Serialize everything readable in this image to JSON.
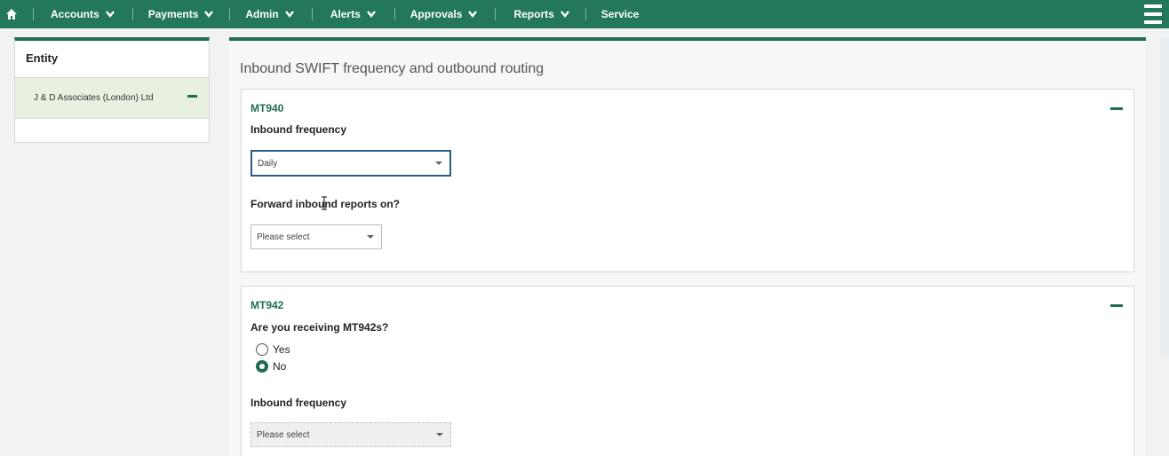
{
  "nav": {
    "items": [
      {
        "label": "Accounts",
        "has_chevron": true
      },
      {
        "label": "Payments",
        "has_chevron": true
      },
      {
        "label": "Admin",
        "has_chevron": true
      },
      {
        "label": "Alerts",
        "has_chevron": true
      },
      {
        "label": "Approvals",
        "has_chevron": true
      },
      {
        "label": "Reports",
        "has_chevron": true
      },
      {
        "label": "Service",
        "has_chevron": false
      }
    ],
    "bg_color": "#23785a"
  },
  "entity_panel": {
    "heading": "Entity",
    "selected_entity": "J & D Associates (London) Ltd"
  },
  "main": {
    "title": "Inbound SWIFT frequency and outbound routing",
    "mt940": {
      "title": "MT940",
      "inbound_frequency_label": "Inbound frequency",
      "inbound_frequency_value": "Daily",
      "forward_label": "Forward inbound reports on?",
      "forward_value": "Please select"
    },
    "mt942": {
      "title": "MT942",
      "receiving_label": "Are you receiving MT942s?",
      "options": [
        "Yes",
        "No"
      ],
      "selected": "No",
      "inbound_frequency_label": "Inbound frequency",
      "inbound_frequency_value": "Please select"
    }
  },
  "colors": {
    "accent": "#1f6e52",
    "selected_bg": "#e7f0e1",
    "focus_border": "#2a5d8c"
  }
}
